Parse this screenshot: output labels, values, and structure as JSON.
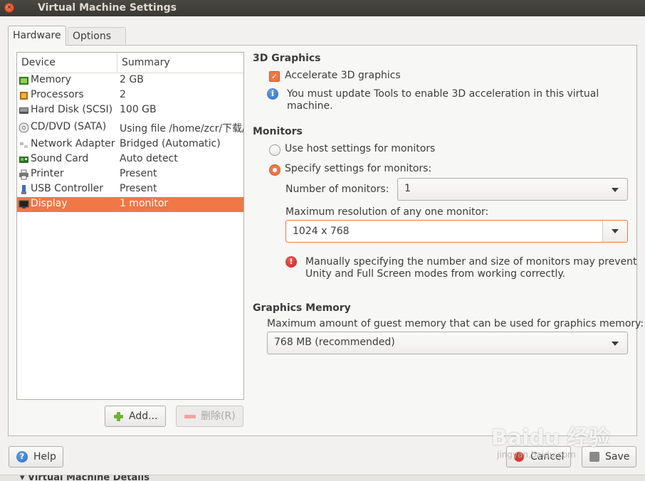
{
  "window": {
    "title": "Virtual Machine Settings"
  },
  "tabs": [
    {
      "label": "Hardware"
    },
    {
      "label": "Options"
    }
  ],
  "device_list": {
    "headers": {
      "device": "Device",
      "summary": "Summary"
    },
    "rows": [
      {
        "name": "Memory",
        "summary": "2 GB",
        "icon": "memory-icon"
      },
      {
        "name": "Processors",
        "summary": "2",
        "icon": "processor-icon"
      },
      {
        "name": "Hard Disk (SCSI)",
        "summary": "100 GB",
        "icon": "hard-disk-icon"
      },
      {
        "name": "CD/DVD (SATA)",
        "summary": "Using file /home/zcr/下载/",
        "icon": "cd-dvd-icon"
      },
      {
        "name": "Network Adapter",
        "summary": "Bridged (Automatic)",
        "icon": "network-icon"
      },
      {
        "name": "Sound Card",
        "summary": "Auto detect",
        "icon": "sound-card-icon"
      },
      {
        "name": "Printer",
        "summary": "Present",
        "icon": "printer-icon"
      },
      {
        "name": "USB Controller",
        "summary": "Present",
        "icon": "usb-icon"
      },
      {
        "name": "Display",
        "summary": "1 monitor",
        "icon": "display-icon",
        "selected": true
      }
    ],
    "add_label": "Add...",
    "remove_label": "删除(R)"
  },
  "graphics": {
    "heading": "3D Graphics",
    "accelerate_label": "Accelerate 3D graphics",
    "accelerate_checked": true,
    "info_line1": "You must update Tools to enable 3D acceleration in this virtual",
    "info_line2": "machine."
  },
  "monitors": {
    "heading": "Monitors",
    "use_host_label": "Use host settings for monitors",
    "specify_label": "Specify settings for monitors:",
    "selected_option": "specify",
    "number_label": "Number of monitors:",
    "number_value": "1",
    "max_res_label": "Maximum resolution of any one monitor:",
    "max_res_value": "1024 x 768",
    "warning_line1": "Manually specifying the number and size of monitors may prevent",
    "warning_line2": "Unity and Full Screen modes from working correctly."
  },
  "graphics_memory": {
    "heading": "Graphics Memory",
    "label": "Maximum amount of guest memory that can be used for graphics memory:",
    "value": "768 MB (recommended)"
  },
  "footer": {
    "help_label": "Help",
    "cancel_label": "Cancel",
    "save_label": "Save"
  },
  "below_window": {
    "label": "▾ Virtual Machine Details"
  },
  "watermark": {
    "text": "Baidu 经验",
    "sub": "jingyan.baidu.com"
  },
  "colors": {
    "accent": "#f07746",
    "titlebar": "#3c3b37"
  }
}
